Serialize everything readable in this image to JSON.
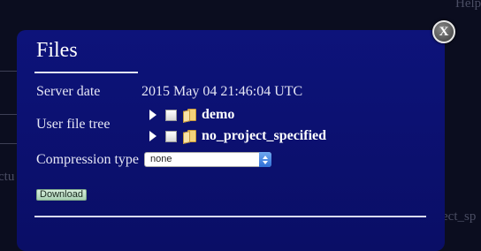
{
  "background": {
    "help_fragment": "Help",
    "left_fragment": "ctu",
    "right_fragment": "ect_sp"
  },
  "dialog": {
    "title": "Files",
    "close_label": "X",
    "server_date": {
      "label": "Server date",
      "value": "2015 May 04 21:46:04 UTC"
    },
    "file_tree": {
      "label": "User file tree",
      "items": [
        {
          "name": "demo",
          "icon": "folder-icon"
        },
        {
          "name": "no_project_specified",
          "icon": "folder-icon"
        }
      ]
    },
    "compression": {
      "label": "Compression type",
      "selected": "none"
    },
    "download_label": "Download"
  },
  "colors": {
    "modal_bg": "#0d137a",
    "page_bg": "#0b0d1f",
    "button_green": "#a8cfb3"
  }
}
